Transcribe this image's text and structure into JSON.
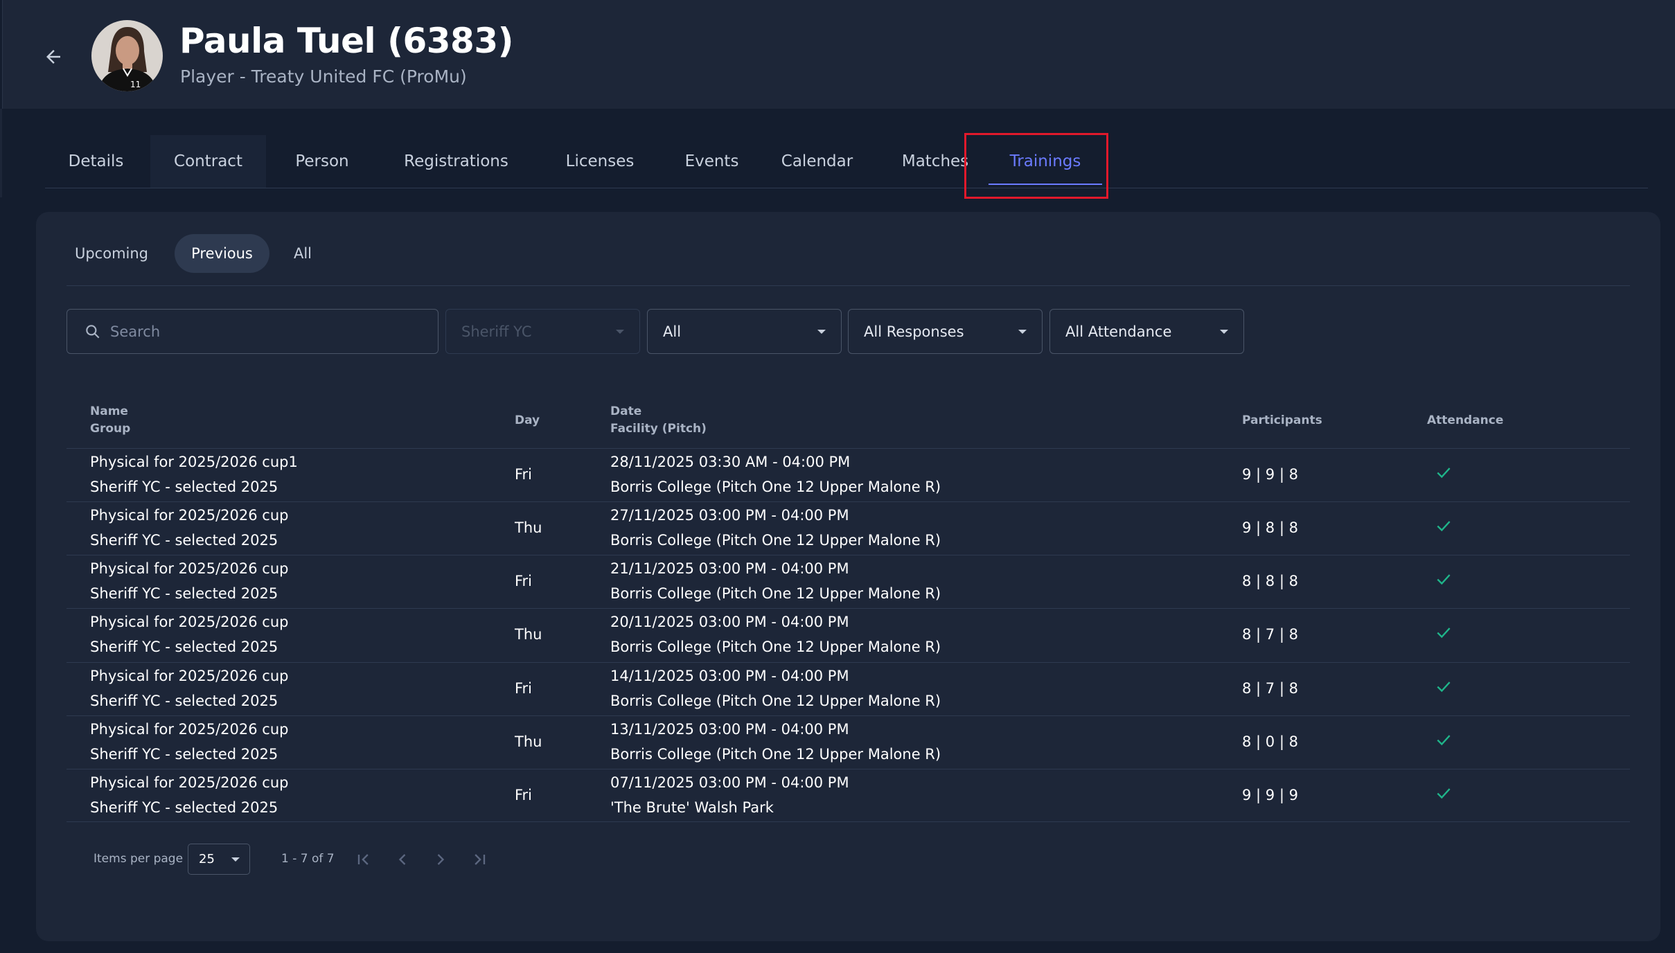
{
  "header": {
    "title": "Paula Tuel (6383)",
    "subtitle": "Player - Treaty United FC (ProMu)"
  },
  "tabs": [
    {
      "label": "Details"
    },
    {
      "label": "Contract"
    },
    {
      "label": "Person"
    },
    {
      "label": "Registrations"
    },
    {
      "label": "Licenses"
    },
    {
      "label": "Events"
    },
    {
      "label": "Calendar"
    },
    {
      "label": "Matches"
    },
    {
      "label": "Trainings"
    }
  ],
  "active_tab": "Trainings",
  "subtabs": [
    {
      "label": "Upcoming"
    },
    {
      "label": "Previous"
    },
    {
      "label": "All"
    }
  ],
  "selected_subtab": "Previous",
  "filters": {
    "search_placeholder": "Search",
    "team": "Sheriff YC",
    "type": "All",
    "responses": "All Responses",
    "attendance": "All Attendance"
  },
  "table": {
    "headers": {
      "name": "Name",
      "group": "Group",
      "day": "Day",
      "date": "Date",
      "facility": "Facility (Pitch)",
      "participants": "Participants",
      "attendance": "Attendance"
    },
    "rows": [
      {
        "name": "Physical for 2025/2026 cup1",
        "group": "Sheriff YC - selected 2025",
        "day": "Fri",
        "date": "28/11/2025 03:30 AM - 04:00 PM",
        "facility": "Borris College (Pitch One 12 Upper Malone R)",
        "participants": "9 | 9 | 8",
        "attended": true
      },
      {
        "name": "Physical for 2025/2026 cup",
        "group": "Sheriff YC - selected 2025",
        "day": "Thu",
        "date": "27/11/2025 03:00 PM - 04:00 PM",
        "facility": "Borris College (Pitch One 12 Upper Malone R)",
        "participants": "9 | 8 | 8",
        "attended": true
      },
      {
        "name": "Physical for 2025/2026 cup",
        "group": "Sheriff YC - selected 2025",
        "day": "Fri",
        "date": "21/11/2025 03:00 PM - 04:00 PM",
        "facility": "Borris College (Pitch One 12 Upper Malone R)",
        "participants": "8 | 8 | 8",
        "attended": true
      },
      {
        "name": "Physical for 2025/2026 cup",
        "group": "Sheriff YC - selected 2025",
        "day": "Thu",
        "date": "20/11/2025 03:00 PM - 04:00 PM",
        "facility": "Borris College (Pitch One 12 Upper Malone R)",
        "participants": "8 | 7 | 8",
        "attended": true
      },
      {
        "name": "Physical for 2025/2026 cup",
        "group": "Sheriff YC - selected 2025",
        "day": "Fri",
        "date": "14/11/2025 03:00 PM - 04:00 PM",
        "facility": "Borris College (Pitch One 12 Upper Malone R)",
        "participants": "8 | 7 | 8",
        "attended": true
      },
      {
        "name": "Physical for 2025/2026 cup",
        "group": "Sheriff YC - selected 2025",
        "day": "Thu",
        "date": "13/11/2025 03:00 PM - 04:00 PM",
        "facility": "Borris College (Pitch One 12 Upper Malone R)",
        "participants": "8 | 0 | 8",
        "attended": true
      },
      {
        "name": "Physical for 2025/2026 cup",
        "group": "Sheriff YC - selected 2025",
        "day": "Fri",
        "date": "07/11/2025 03:00 PM - 04:00 PM",
        "facility": "'The Brute' Walsh Park",
        "participants": "9 | 9 | 9",
        "attended": true
      }
    ]
  },
  "pagination": {
    "items_per_page_label": "Items per page",
    "page_size": "25",
    "range": "1 - 7 of 7"
  },
  "colors": {
    "accent": "#6b7bff",
    "highlight_box": "#e1192b",
    "check": "#1fb58a"
  }
}
